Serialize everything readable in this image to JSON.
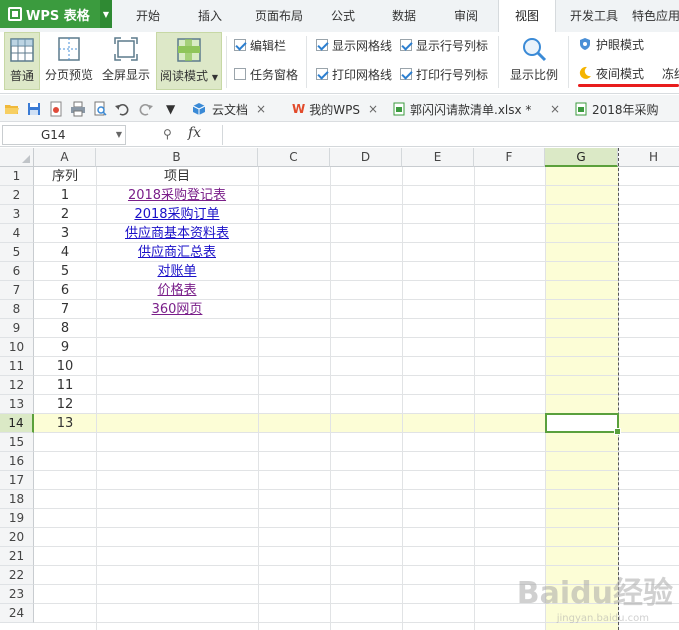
{
  "app": {
    "title": "WPS 表格"
  },
  "menu": {
    "tabs": [
      "开始",
      "插入",
      "页面布局",
      "公式",
      "数据",
      "审阅",
      "视图",
      "开发工具",
      "特色应用"
    ],
    "active": "视图"
  },
  "ribbon": {
    "normal": "普通",
    "page_break_preview": "分页预览",
    "full_screen": "全屏显示",
    "reading_mode": "阅读模式",
    "formula_bar": "编辑栏",
    "task_pane": "任务窗格",
    "show_gridlines": "显示网格线",
    "print_gridlines": "打印网格线",
    "show_headers": "显示行号列标",
    "print_headers": "打印行号列标",
    "zoom": "显示比例",
    "eye_protection": "护眼模式",
    "night_mode": "夜间模式",
    "freeze": "冻结"
  },
  "checks": {
    "formula_bar": true,
    "task_pane": false,
    "show_gridlines": true,
    "print_gridlines": true,
    "show_headers": true,
    "print_headers": true
  },
  "doc_tabs": {
    "cloud": "云文档",
    "mywps": "我的WPS",
    "file1": "郭闪闪请款清单.xlsx *",
    "file2": "2018年采购"
  },
  "formula_bar": {
    "cell_ref": "G14",
    "fx": "fx",
    "value": ""
  },
  "sheet": {
    "columns": [
      "A",
      "B",
      "C",
      "D",
      "E",
      "F",
      "G",
      "H"
    ],
    "selected_column": "G",
    "selected_row": 14,
    "rows": [
      "1",
      "2",
      "3",
      "4",
      "5",
      "6",
      "7",
      "8",
      "9",
      "10",
      "11",
      "12",
      "13",
      "14",
      "15",
      "16",
      "17",
      "18",
      "19",
      "20",
      "21",
      "22",
      "23",
      "24"
    ],
    "header": {
      "a": "序列",
      "b": "项目"
    },
    "data": [
      {
        "a": "1",
        "b": "2018采购登记表",
        "visited": true
      },
      {
        "a": "2",
        "b": "2018采购订单",
        "visited": false
      },
      {
        "a": "3",
        "b": "供应商基本资料表",
        "visited": false
      },
      {
        "a": "4",
        "b": "供应商汇总表",
        "visited": false
      },
      {
        "a": "5",
        "b": "对账单",
        "visited": false
      },
      {
        "a": "6",
        "b": "价格表",
        "visited": true
      },
      {
        "a": "7",
        "b": "360网页",
        "visited": true
      },
      {
        "a": "8",
        "b": ""
      },
      {
        "a": "9",
        "b": ""
      },
      {
        "a": "10",
        "b": ""
      },
      {
        "a": "11",
        "b": ""
      },
      {
        "a": "12",
        "b": ""
      },
      {
        "a": "13",
        "b": ""
      }
    ]
  },
  "watermark": {
    "brand": "Baidu经验",
    "url": "jingyan.baidu.com"
  },
  "colors": {
    "accent": "#3b9b3e",
    "selection": "#5aa03d",
    "highlight": "#fcfdd6",
    "link": "#1a10c8",
    "visited": "#7a1f8a",
    "annotation": "#e81c1c"
  }
}
